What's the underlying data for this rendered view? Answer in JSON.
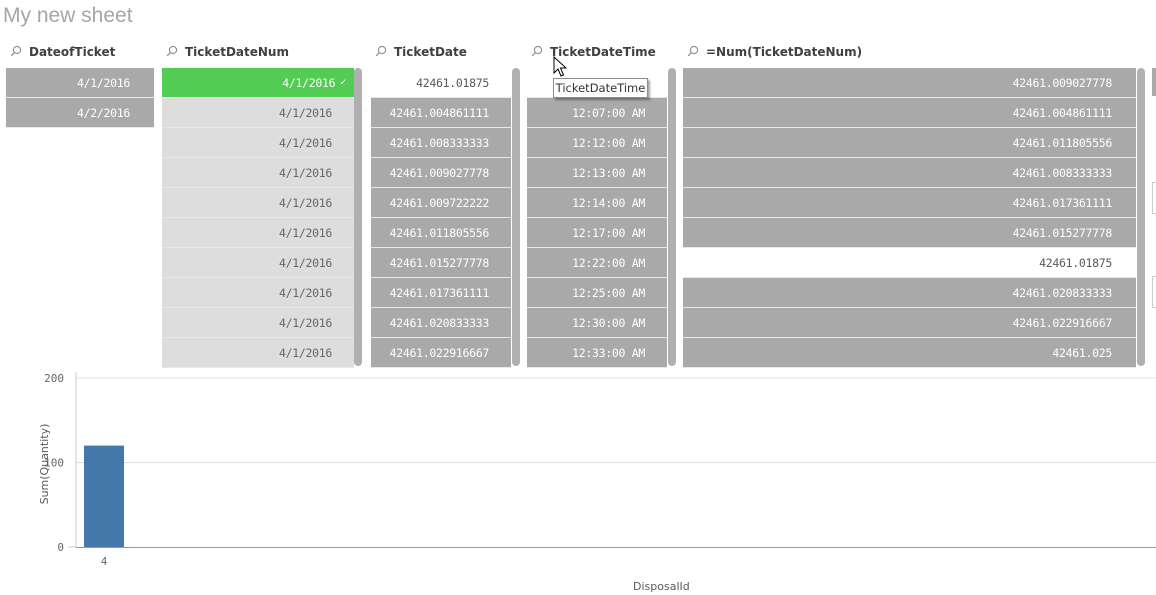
{
  "sheet": {
    "title": "My new sheet"
  },
  "listboxes": [
    {
      "id": "dateofticket",
      "title": "DateofTicket",
      "rows": [
        {
          "value": "4/1/2016",
          "state": "alternative"
        },
        {
          "value": "4/2/2016",
          "state": "alternative"
        }
      ]
    },
    {
      "id": "ticketdatenum",
      "title": "TicketDateNum",
      "rows": [
        {
          "value": "4/1/2016",
          "state": "selected",
          "check": "✓"
        },
        {
          "value": "4/1/2016",
          "state": "excluded"
        },
        {
          "value": "4/1/2016",
          "state": "excluded"
        },
        {
          "value": "4/1/2016",
          "state": "excluded"
        },
        {
          "value": "4/1/2016",
          "state": "excluded"
        },
        {
          "value": "4/1/2016",
          "state": "excluded"
        },
        {
          "value": "4/1/2016",
          "state": "excluded"
        },
        {
          "value": "4/1/2016",
          "state": "excluded"
        },
        {
          "value": "4/1/2016",
          "state": "excluded"
        },
        {
          "value": "4/1/2016",
          "state": "excluded"
        }
      ]
    },
    {
      "id": "ticketdate",
      "title": "TicketDate",
      "rows": [
        {
          "value": "42461.01875",
          "state": "possible"
        },
        {
          "value": "42461.004861111",
          "state": "alternative"
        },
        {
          "value": "42461.008333333",
          "state": "alternative"
        },
        {
          "value": "42461.009027778",
          "state": "alternative"
        },
        {
          "value": "42461.009722222",
          "state": "alternative"
        },
        {
          "value": "42461.011805556",
          "state": "alternative"
        },
        {
          "value": "42461.015277778",
          "state": "alternative"
        },
        {
          "value": "42461.017361111",
          "state": "alternative"
        },
        {
          "value": "42461.020833333",
          "state": "alternative"
        },
        {
          "value": "42461.022916667",
          "state": "alternative"
        }
      ]
    },
    {
      "id": "ticketdatetime",
      "title": "TicketDateTime",
      "rows": [
        {
          "value": "",
          "state": "possible"
        },
        {
          "value": "12:07:00 AM",
          "state": "alternative"
        },
        {
          "value": "12:12:00 AM",
          "state": "alternative"
        },
        {
          "value": "12:13:00 AM",
          "state": "alternative"
        },
        {
          "value": "12:14:00 AM",
          "state": "alternative"
        },
        {
          "value": "12:17:00 AM",
          "state": "alternative"
        },
        {
          "value": "12:22:00 AM",
          "state": "alternative"
        },
        {
          "value": "12:25:00 AM",
          "state": "alternative"
        },
        {
          "value": "12:30:00 AM",
          "state": "alternative"
        },
        {
          "value": "12:33:00 AM",
          "state": "alternative"
        }
      ]
    },
    {
      "id": "numticketdatenum",
      "title": "=Num(TicketDateNum)",
      "rows": [
        {
          "value": "42461.009027778",
          "state": "alternative"
        },
        {
          "value": "42461.004861111",
          "state": "alternative"
        },
        {
          "value": "42461.011805556",
          "state": "alternative"
        },
        {
          "value": "42461.008333333",
          "state": "alternative"
        },
        {
          "value": "42461.017361111",
          "state": "alternative"
        },
        {
          "value": "42461.015277778",
          "state": "alternative"
        },
        {
          "value": "42461.01875",
          "state": "possible"
        },
        {
          "value": "42461.020833333",
          "state": "alternative"
        },
        {
          "value": "42461.022916667",
          "state": "alternative"
        },
        {
          "value": "42461.025",
          "state": "alternative"
        }
      ]
    }
  ],
  "tooltip": {
    "text": "TicketDateTime"
  },
  "colors": {
    "selected": "#52cc52",
    "alternative": "#a9a9a9",
    "excluded": "#dddddd",
    "possible": "#ffffff",
    "bar": "#4477aa"
  },
  "chart_data": {
    "type": "bar",
    "title": "",
    "xlabel": "DisposalId",
    "ylabel": "Sum(Quantity)",
    "categories": [
      "4"
    ],
    "values": [
      120
    ],
    "ylim": [
      0,
      200
    ],
    "yticks": [
      "0",
      "100",
      "200"
    ],
    "grid": true,
    "legend": "none"
  }
}
